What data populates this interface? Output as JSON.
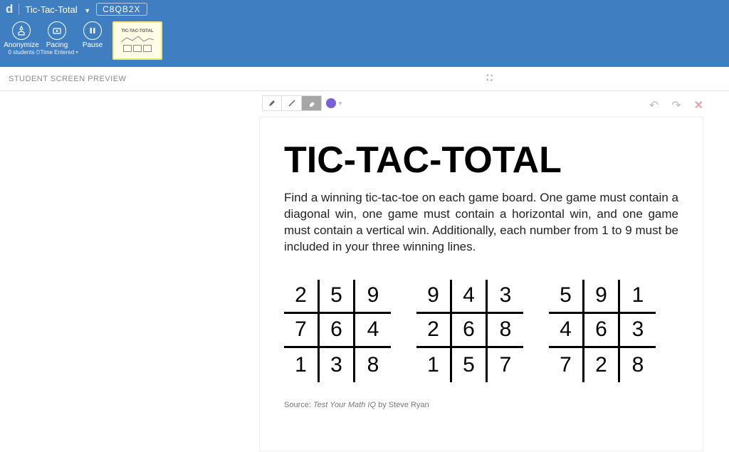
{
  "header": {
    "brand": "d",
    "title": "Tic-Tac-Total",
    "code": "C8QB2X"
  },
  "toolbar_top": {
    "anonymize": {
      "label": "Anonymize",
      "sub": "0 students"
    },
    "pacing": {
      "label": "Pacing",
      "sub": "⏱Time Entered ▾"
    },
    "pause": {
      "label": "Pause"
    },
    "thumb_label": "TIC-TAC-TOTAL"
  },
  "secondbar": {
    "label": "STUDENT SCREEN PREVIEW"
  },
  "draw_toolbar": {
    "pencil": "pencil-tool",
    "line": "line-tool",
    "eraser": "eraser-tool",
    "color": "#7b5fd9"
  },
  "right_tools": {
    "undo": "↶",
    "redo": "↷",
    "close": "✕"
  },
  "document": {
    "title": "TIC-TAC-TOTAL",
    "body": "Find a winning tic-tac-toe on each game board. One game must contain a diagonal win, one game must contain a horizontal win, and one game must contain a vertical win. Additionally, each number from 1 to 9 must be included in your three winning lines.",
    "boards": [
      [
        [
          2,
          5,
          9
        ],
        [
          7,
          6,
          4
        ],
        [
          1,
          3,
          8
        ]
      ],
      [
        [
          9,
          4,
          3
        ],
        [
          2,
          6,
          8
        ],
        [
          1,
          5,
          7
        ]
      ],
      [
        [
          5,
          9,
          1
        ],
        [
          4,
          6,
          3
        ],
        [
          7,
          2,
          8
        ]
      ]
    ],
    "source_prefix": "Source: ",
    "source_title": "Test Your Math IQ",
    "source_suffix": " by Steve Ryan"
  }
}
